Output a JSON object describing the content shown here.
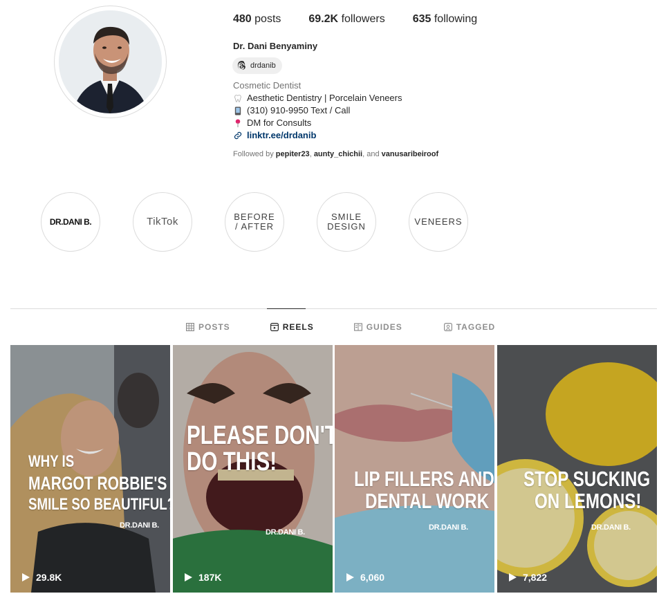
{
  "profile": {
    "stats": {
      "posts_value": "480",
      "posts_label": "posts",
      "followers_value": "69.2K",
      "followers_label": "followers",
      "following_value": "635",
      "following_label": "following"
    },
    "name": "Dr. Dani Benyaminy",
    "threads_handle": "drdanib",
    "category": "Cosmetic Dentist",
    "bio_lines": [
      {
        "icon": "tooth-icon",
        "text": "Aesthetic Dentistry | Porcelain Veneers"
      },
      {
        "icon": "phone-icon",
        "text": "(310) 910-9950 Text / Call"
      },
      {
        "icon": "pin-icon",
        "text": "DM for Consults"
      }
    ],
    "link": "linktr.ee/drdanib",
    "followed_by": {
      "prefix": "Followed by",
      "user1": "pepiter23",
      "sep": ",",
      "user2": "aunty_chichii",
      "and": ", and",
      "user3": "vanusaribeiroof"
    }
  },
  "highlights": [
    {
      "label": "DR.DANI B."
    },
    {
      "label": "TikTok"
    },
    {
      "label": "BEFORE / AFTER"
    },
    {
      "label": "SMILE DESIGN"
    },
    {
      "label": "VENEERS"
    }
  ],
  "tabs": [
    {
      "label": "POSTS",
      "icon": "grid-icon"
    },
    {
      "label": "REELS",
      "icon": "reels-icon",
      "active": true
    },
    {
      "label": "GUIDES",
      "icon": "guides-icon"
    },
    {
      "label": "TAGGED",
      "icon": "tagged-icon"
    }
  ],
  "reels": [
    {
      "caption_line1": "WHY IS",
      "caption_line2": "MARGOT ROBBIE'S",
      "caption_line3": "SMILE SO BEAUTIFUL?",
      "logo": "DR.DANI B.",
      "views": "29.8K"
    },
    {
      "caption_line1": "PLEASE DON'T",
      "caption_line2": "DO THIS!",
      "logo": "DR.DANI B.",
      "views": "187K"
    },
    {
      "caption_line1": "LIP FILLERS AND",
      "caption_line2": "DENTAL WORK",
      "logo": "DR.DANI B.",
      "views": "6,060"
    },
    {
      "caption_line1": "STOP SUCKING",
      "caption_line2": "ON LEMONS!",
      "logo": "DR.DANI B.",
      "views": "7,822"
    }
  ],
  "colors": {
    "link": "#00376b",
    "muted": "#737373",
    "border": "#dbdbdb",
    "pill": "#efefef"
  }
}
